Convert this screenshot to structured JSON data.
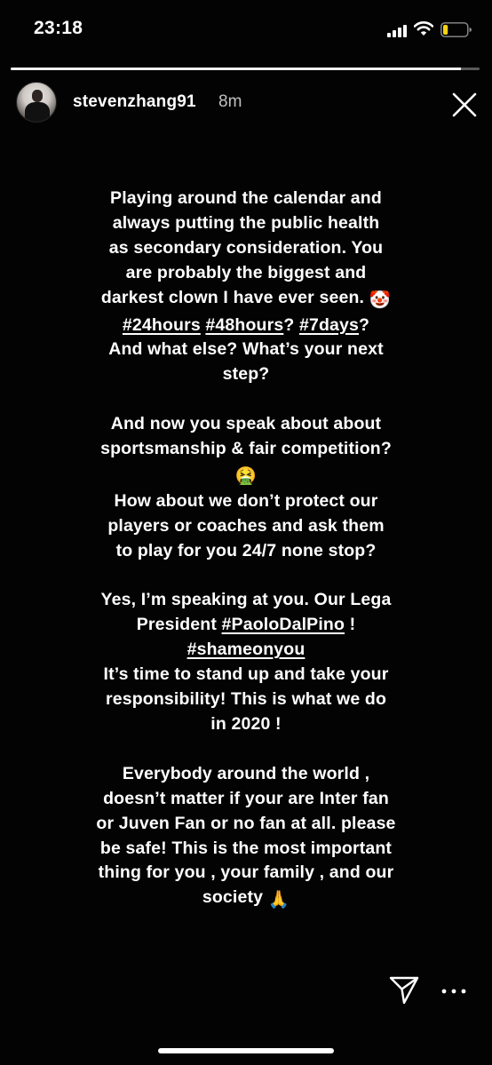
{
  "status_bar": {
    "time": "23:18",
    "signal_icon": "cellular-signal-icon",
    "wifi_icon": "wifi-icon",
    "battery_icon": "battery-low-icon",
    "battery_level": 0.2,
    "battery_color": "#f5d315"
  },
  "story": {
    "progress": 0.96,
    "username": "stevenzhang91",
    "time_ago": "8m",
    "close_icon": "close-icon",
    "send_icon": "send-icon",
    "more_icon": "more-options-icon",
    "paragraphs": [
      {
        "lines": [
          {
            "parts": [
              {
                "text": "Playing around the calendar and"
              }
            ]
          },
          {
            "parts": [
              {
                "text": "always putting the public health"
              }
            ]
          },
          {
            "parts": [
              {
                "text": "as secondary consideration. You"
              }
            ]
          },
          {
            "parts": [
              {
                "text": "are probably the biggest and"
              }
            ]
          },
          {
            "parts": [
              {
                "text": "darkest clown I have ever seen. "
              },
              {
                "emoji": "🤡"
              }
            ]
          },
          {
            "parts": [
              {
                "tag": "#24hours"
              },
              {
                "text": " "
              },
              {
                "tag": "#48hours"
              },
              {
                "text": "? "
              },
              {
                "tag": "#7days"
              },
              {
                "text": "?"
              }
            ]
          },
          {
            "parts": [
              {
                "text": "And what else?  What’s your next"
              }
            ]
          },
          {
            "parts": [
              {
                "text": "step?"
              }
            ]
          }
        ]
      },
      {
        "lines": [
          {
            "parts": [
              {
                "text": "And now you speak about about"
              }
            ]
          },
          {
            "parts": [
              {
                "text": "sportsmanship & fair competition?"
              }
            ]
          },
          {
            "parts": [
              {
                "emoji": "🤮"
              }
            ]
          },
          {
            "parts": [
              {
                "text": "How about we don’t protect our"
              }
            ]
          },
          {
            "parts": [
              {
                "text": "players or coaches and ask them"
              }
            ]
          },
          {
            "parts": [
              {
                "text": "to play for you 24/7 none stop?"
              }
            ]
          }
        ]
      },
      {
        "lines": [
          {
            "parts": [
              {
                "text": "Yes, I’m speaking at you. Our Lega"
              }
            ]
          },
          {
            "parts": [
              {
                "text": "President "
              },
              {
                "tag": "#PaoloDalPino"
              },
              {
                "text": " !"
              }
            ]
          },
          {
            "parts": [
              {
                "tag": "#shameonyou"
              }
            ]
          },
          {
            "parts": [
              {
                "text": "It’s time to stand up and take your"
              }
            ]
          },
          {
            "parts": [
              {
                "text": "responsibility!  This is what we do"
              }
            ]
          },
          {
            "parts": [
              {
                "text": "in 2020 !"
              }
            ]
          }
        ]
      },
      {
        "lines": [
          {
            "parts": [
              {
                "text": "Everybody around the world ,"
              }
            ]
          },
          {
            "parts": [
              {
                "text": "doesn’t matter if your are Inter fan"
              }
            ]
          },
          {
            "parts": [
              {
                "text": "or Juven Fan or no fan at all. please"
              }
            ]
          },
          {
            "parts": [
              {
                "text": "be safe! This is the most important"
              }
            ]
          },
          {
            "parts": [
              {
                "text": "thing for you , your family , and our"
              }
            ]
          },
          {
            "parts": [
              {
                "text": "society "
              },
              {
                "emoji": "🙏"
              }
            ]
          }
        ]
      }
    ]
  }
}
